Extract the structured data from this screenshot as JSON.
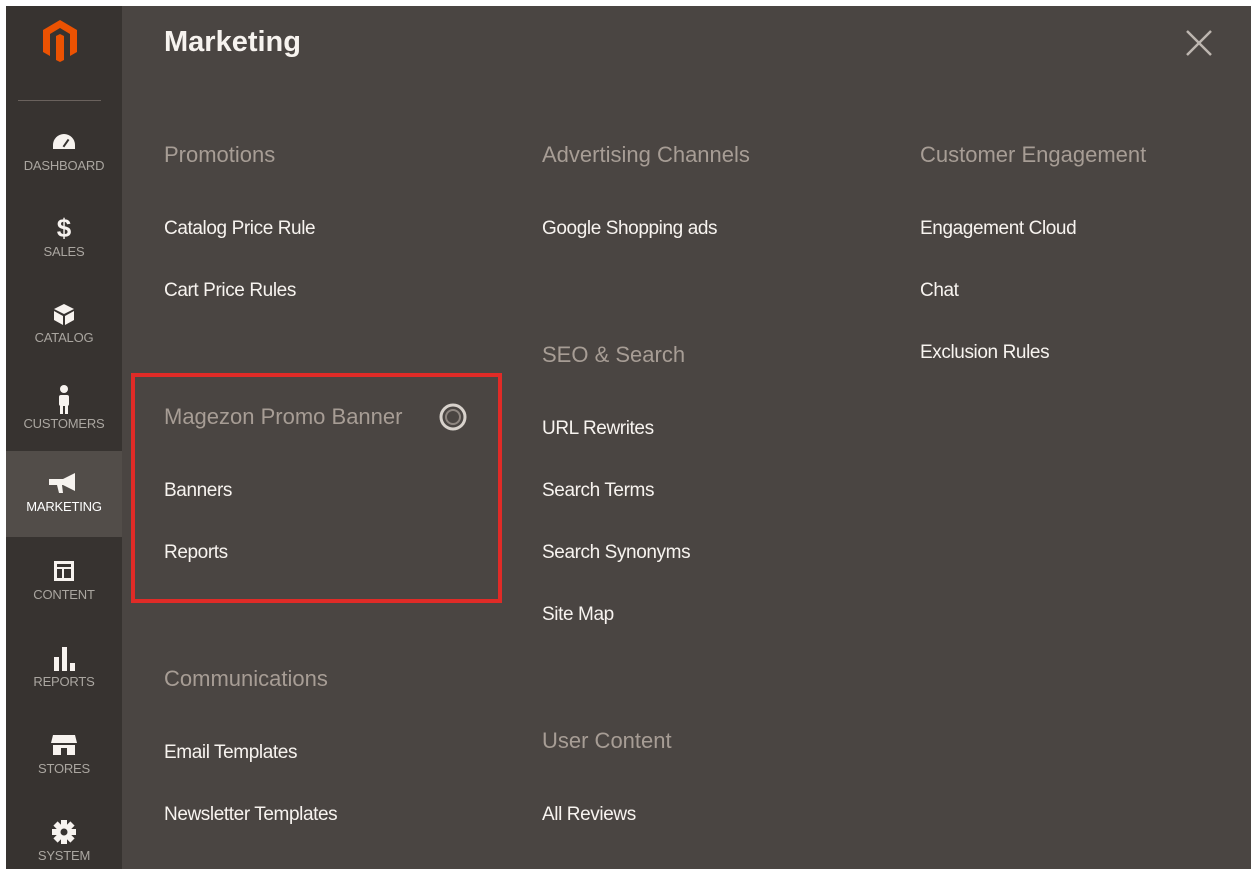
{
  "sidebar": {
    "items": [
      {
        "label": "DASHBOARD",
        "icon": "dashboard-icon"
      },
      {
        "label": "SALES",
        "icon": "dollar-icon"
      },
      {
        "label": "CATALOG",
        "icon": "box-icon"
      },
      {
        "label": "CUSTOMERS",
        "icon": "person-icon"
      },
      {
        "label": "MARKETING",
        "icon": "megaphone-icon",
        "active": true
      },
      {
        "label": "CONTENT",
        "icon": "layout-icon"
      },
      {
        "label": "REPORTS",
        "icon": "bar-chart-icon"
      },
      {
        "label": "STORES",
        "icon": "store-icon"
      },
      {
        "label": "SYSTEM",
        "icon": "gear-icon"
      }
    ]
  },
  "panel": {
    "title": "Marketing",
    "close_icon": "close-icon"
  },
  "columns": {
    "col1": {
      "promotions": {
        "title": "Promotions",
        "links": [
          "Catalog Price Rule",
          "Cart Price Rules"
        ]
      },
      "promo_banner": {
        "title": "Magezon Promo Banner",
        "links": [
          "Banners",
          "Reports"
        ]
      },
      "communications": {
        "title": "Communications",
        "links": [
          "Email Templates",
          "Newsletter Templates"
        ]
      }
    },
    "col2": {
      "advertising": {
        "title": "Advertising Channels",
        "links": [
          "Google Shopping ads"
        ]
      },
      "seo": {
        "title": "SEO & Search",
        "links": [
          "URL Rewrites",
          "Search Terms",
          "Search Synonyms",
          "Site Map"
        ]
      },
      "user_content": {
        "title": "User Content",
        "links": [
          "All Reviews"
        ]
      }
    },
    "col3": {
      "engagement": {
        "title": "Customer Engagement",
        "links": [
          "Engagement Cloud",
          "Chat",
          "Exclusion Rules"
        ]
      }
    }
  },
  "colors": {
    "sidebar_bg": "#373330",
    "panel_bg": "#4a4542",
    "active_bg": "#524d49",
    "highlight_border": "#e02b27",
    "logo_orange": "#eb5202"
  }
}
